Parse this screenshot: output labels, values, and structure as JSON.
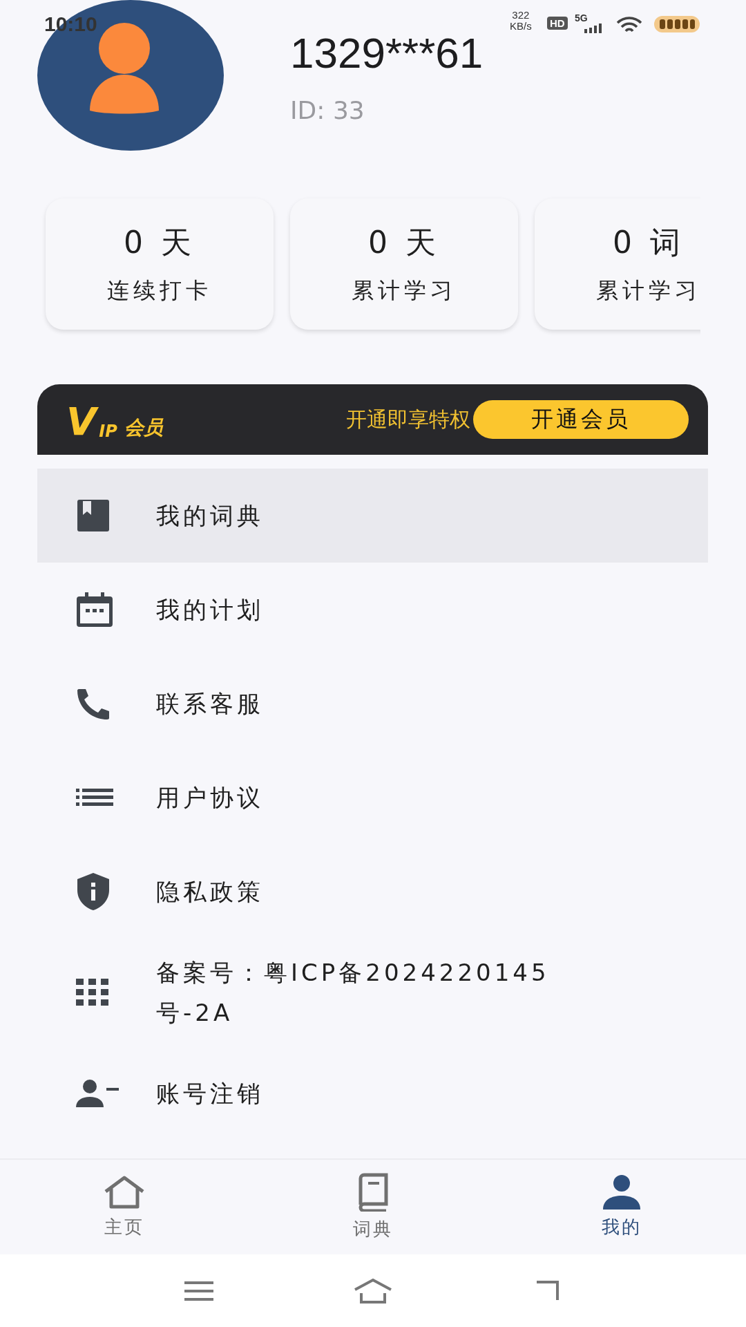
{
  "status_bar": {
    "time": "10:10",
    "speed": "322",
    "speed_unit": "KB/s",
    "hd": "HD",
    "network": "5G"
  },
  "profile": {
    "phone": "1329***61",
    "id": "ID: 33"
  },
  "stats": [
    {
      "value": "0 天",
      "label": "连续打卡"
    },
    {
      "value": "0 天",
      "label": "累计学习"
    },
    {
      "value": "0 词",
      "label": "累计学习"
    }
  ],
  "vip": {
    "logo_v": "V",
    "logo_ip": "IP",
    "logo_text": "会员",
    "slogan": "开通即享特权",
    "button": "开通会员"
  },
  "menu": [
    {
      "label": "我的词典",
      "selected": true
    },
    {
      "label": "我的计划",
      "selected": false
    },
    {
      "label": "联系客服",
      "selected": false
    },
    {
      "label": "用户协议",
      "selected": false
    },
    {
      "label": "隐私政策",
      "selected": false
    },
    {
      "label": "备案号：粤ICP备2024220145号-2A",
      "selected": false
    },
    {
      "label": "账号注销",
      "selected": false
    }
  ],
  "tabs": [
    {
      "label": "主页",
      "selected": false
    },
    {
      "label": "词典",
      "selected": false
    },
    {
      "label": "我的",
      "selected": true
    }
  ]
}
